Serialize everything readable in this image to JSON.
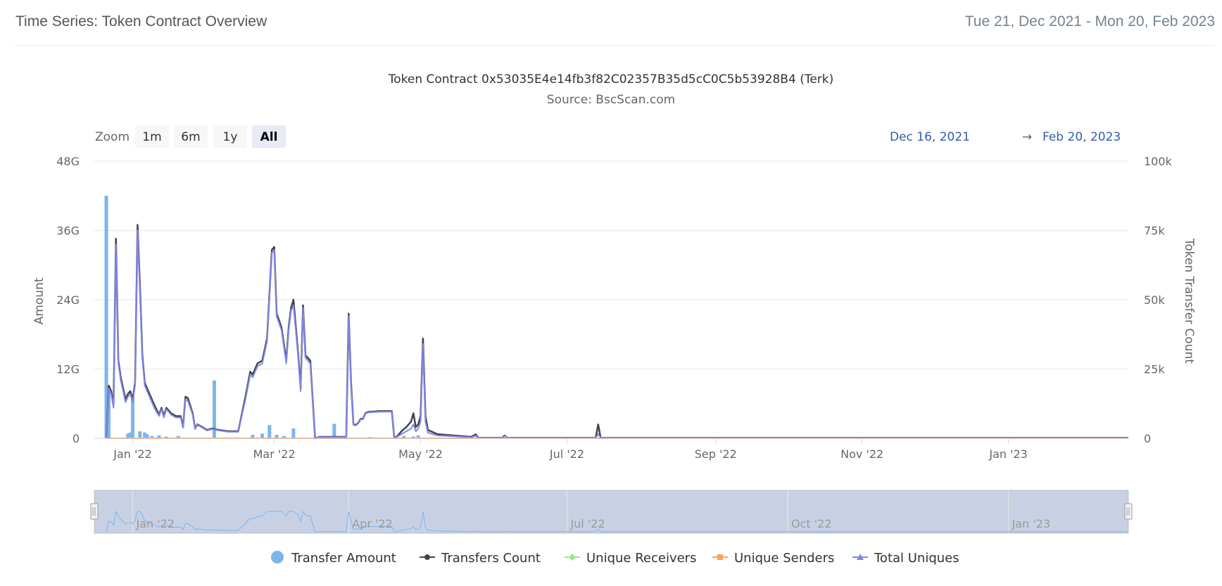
{
  "header": {
    "title": "Time Series: Token Contract Overview",
    "date_range": "Tue 21, Dec 2021 - Mon 20, Feb 2023"
  },
  "chart_data": {
    "type": "line",
    "title": "Token Contract 0x53035E4e14fb3f82C02357B35d5cC0C5b53928B4 (Terk)",
    "subtitle": "Source: BscScan.com",
    "zoom": {
      "label": "Zoom",
      "buttons": [
        "1m",
        "6m",
        "1y",
        "All"
      ],
      "selected": "All"
    },
    "range_selector": {
      "from": "Dec 16, 2021",
      "arrow": "→",
      "to": "Feb 20, 2023"
    },
    "x_start": "2021-12-16",
    "x_end": "2023-02-20",
    "xticks": [
      {
        "label": "Jan '22",
        "date": "2022-01-01"
      },
      {
        "label": "Mar '22",
        "date": "2022-03-01"
      },
      {
        "label": "May '22",
        "date": "2022-05-01"
      },
      {
        "label": "Jul '22",
        "date": "2022-07-01"
      },
      {
        "label": "Sep '22",
        "date": "2022-09-01"
      },
      {
        "label": "Nov '22",
        "date": "2022-11-01"
      },
      {
        "label": "Jan '23",
        "date": "2023-01-01"
      }
    ],
    "navigator_ticks": [
      {
        "label": "Jan '22",
        "date": "2022-01-01"
      },
      {
        "label": "Apr '22",
        "date": "2022-04-01"
      },
      {
        "label": "Jul '22",
        "date": "2022-07-01"
      },
      {
        "label": "Oct '22",
        "date": "2022-10-01"
      },
      {
        "label": "Jan '23",
        "date": "2023-01-01"
      }
    ],
    "y_left": {
      "label": "Amount",
      "ticks": [
        "0",
        "12G",
        "24G",
        "36G",
        "48G"
      ],
      "max": 48
    },
    "y_right": {
      "label": "Token Transfer Count",
      "ticks": [
        "0",
        "25k",
        "50k",
        "75k",
        "100k"
      ],
      "max": 100000
    },
    "grid": true,
    "legend_position": "bottom",
    "colors": {
      "transfer_amount": "#7cb5ec",
      "transfers_count": "#434348",
      "unique_receivers": "#90ed7d",
      "unique_senders": "#f7a35c",
      "total_uniques": "#8085e9"
    },
    "series": [
      {
        "name": "Transfer Amount",
        "type": "column",
        "axis": "left",
        "unit": "G",
        "points": [
          [
            "2021-12-21",
            42
          ],
          [
            "2021-12-22",
            8
          ],
          [
            "2021-12-30",
            0.8
          ],
          [
            "2021-12-31",
            1.0
          ],
          [
            "2022-01-01",
            7.5
          ],
          [
            "2022-01-04",
            1.2
          ],
          [
            "2022-01-06",
            1.0
          ],
          [
            "2022-01-07",
            0.7
          ],
          [
            "2022-01-09",
            0.4
          ],
          [
            "2022-01-12",
            0.5
          ],
          [
            "2022-01-15",
            0.3
          ],
          [
            "2022-01-20",
            0.4
          ],
          [
            "2022-02-04",
            10
          ],
          [
            "2022-02-20",
            0.6
          ],
          [
            "2022-02-24",
            0.8
          ],
          [
            "2022-02-27",
            2.3
          ],
          [
            "2022-03-02",
            0.6
          ],
          [
            "2022-03-05",
            0.4
          ],
          [
            "2022-03-09",
            1.7
          ],
          [
            "2022-03-26",
            2.5
          ],
          [
            "2022-04-10",
            0.2
          ],
          [
            "2022-04-24",
            0.4
          ],
          [
            "2022-04-28",
            0.3
          ],
          [
            "2022-04-30",
            0.5
          ]
        ]
      },
      {
        "name": "Transfers Count",
        "axis": "right",
        "points": [
          [
            "2021-12-21",
            0
          ],
          [
            "2021-12-22",
            19000
          ],
          [
            "2021-12-23",
            17000
          ],
          [
            "2021-12-24",
            12000
          ],
          [
            "2021-12-25",
            72000
          ],
          [
            "2021-12-26",
            28000
          ],
          [
            "2021-12-27",
            22000
          ],
          [
            "2021-12-28",
            18000
          ],
          [
            "2021-12-29",
            14000
          ],
          [
            "2021-12-30",
            16000
          ],
          [
            "2021-12-31",
            17000
          ],
          [
            "2022-01-01",
            14000
          ],
          [
            "2022-01-02",
            20000
          ],
          [
            "2022-01-03",
            77000
          ],
          [
            "2022-01-04",
            55000
          ],
          [
            "2022-01-05",
            30000
          ],
          [
            "2022-01-06",
            20000
          ],
          [
            "2022-01-08",
            16000
          ],
          [
            "2022-01-10",
            12000
          ],
          [
            "2022-01-12",
            8500
          ],
          [
            "2022-01-13",
            11000
          ],
          [
            "2022-01-14",
            8000
          ],
          [
            "2022-01-15",
            11000
          ],
          [
            "2022-01-17",
            9000
          ],
          [
            "2022-01-19",
            8000
          ],
          [
            "2022-01-21",
            8000
          ],
          [
            "2022-01-22",
            4000
          ],
          [
            "2022-01-23",
            15000
          ],
          [
            "2022-01-24",
            14500
          ],
          [
            "2022-01-26",
            9000
          ],
          [
            "2022-01-27",
            3500
          ],
          [
            "2022-01-28",
            5000
          ],
          [
            "2022-01-30",
            4000
          ],
          [
            "2022-02-01",
            3000
          ],
          [
            "2022-02-03",
            3500
          ],
          [
            "2022-02-06",
            3000
          ],
          [
            "2022-02-10",
            2500
          ],
          [
            "2022-02-14",
            2500
          ],
          [
            "2022-02-17",
            15000
          ],
          [
            "2022-02-19",
            24000
          ],
          [
            "2022-02-20",
            23000
          ],
          [
            "2022-02-22",
            27000
          ],
          [
            "2022-02-24",
            28000
          ],
          [
            "2022-02-26",
            36000
          ],
          [
            "2022-02-28",
            68000
          ],
          [
            "2022-03-01",
            69000
          ],
          [
            "2022-03-02",
            45000
          ],
          [
            "2022-03-04",
            40000
          ],
          [
            "2022-03-06",
            28000
          ],
          [
            "2022-03-07",
            40000
          ],
          [
            "2022-03-08",
            47000
          ],
          [
            "2022-03-09",
            50000
          ],
          [
            "2022-03-11",
            30000
          ],
          [
            "2022-03-12",
            18000
          ],
          [
            "2022-03-13",
            48000
          ],
          [
            "2022-03-14",
            30000
          ],
          [
            "2022-03-16",
            28000
          ],
          [
            "2022-03-18",
            0
          ],
          [
            "2022-03-20",
            500
          ],
          [
            "2022-03-31",
            500
          ],
          [
            "2022-04-01",
            45000
          ],
          [
            "2022-04-02",
            20000
          ],
          [
            "2022-04-03",
            5000
          ],
          [
            "2022-04-04",
            4800
          ],
          [
            "2022-04-05",
            5500
          ],
          [
            "2022-04-06",
            7000
          ],
          [
            "2022-04-07",
            7000
          ],
          [
            "2022-04-08",
            9000
          ],
          [
            "2022-04-09",
            9500
          ],
          [
            "2022-04-14",
            9800
          ],
          [
            "2022-04-19",
            9800
          ],
          [
            "2022-04-20",
            500
          ],
          [
            "2022-04-21",
            500
          ],
          [
            "2022-04-23",
            2500
          ],
          [
            "2022-04-25",
            4000
          ],
          [
            "2022-04-27",
            6000
          ],
          [
            "2022-04-28",
            9000
          ],
          [
            "2022-04-29",
            4000
          ],
          [
            "2022-04-30",
            5000
          ],
          [
            "2022-05-01",
            8000
          ],
          [
            "2022-05-02",
            36000
          ],
          [
            "2022-05-03",
            8000
          ],
          [
            "2022-05-04",
            3000
          ],
          [
            "2022-05-08",
            1500
          ],
          [
            "2022-05-15",
            1000
          ],
          [
            "2022-05-22",
            500
          ],
          [
            "2022-05-24",
            1400
          ],
          [
            "2022-05-25",
            200
          ],
          [
            "2022-06-04",
            200
          ],
          [
            "2022-06-05",
            1000
          ],
          [
            "2022-06-06",
            200
          ],
          [
            "2022-07-13",
            200
          ],
          [
            "2022-07-14",
            5000
          ],
          [
            "2022-07-15",
            200
          ],
          [
            "2023-02-20",
            200
          ]
        ]
      },
      {
        "name": "Unique Receivers",
        "axis": "right",
        "points": [
          [
            "2021-12-21",
            0
          ],
          [
            "2023-02-20",
            0
          ]
        ]
      },
      {
        "name": "Unique Senders",
        "axis": "right",
        "points": [
          [
            "2021-12-21",
            0
          ],
          [
            "2023-02-20",
            0
          ]
        ]
      },
      {
        "name": "Total Uniques",
        "axis": "right",
        "points": [
          [
            "2021-12-21",
            0
          ],
          [
            "2021-12-22",
            18000
          ],
          [
            "2021-12-23",
            16000
          ],
          [
            "2021-12-24",
            11000
          ],
          [
            "2021-12-25",
            70000
          ],
          [
            "2021-12-26",
            27000
          ],
          [
            "2021-12-27",
            21000
          ],
          [
            "2021-12-28",
            17000
          ],
          [
            "2021-12-29",
            13000
          ],
          [
            "2021-12-30",
            15000
          ],
          [
            "2021-12-31",
            16000
          ],
          [
            "2022-01-01",
            13000
          ],
          [
            "2022-01-02",
            19000
          ],
          [
            "2022-01-03",
            75000
          ],
          [
            "2022-01-04",
            53000
          ],
          [
            "2022-01-05",
            29000
          ],
          [
            "2022-01-06",
            19000
          ],
          [
            "2022-01-08",
            15000
          ],
          [
            "2022-01-10",
            11000
          ],
          [
            "2022-01-12",
            8000
          ],
          [
            "2022-01-13",
            10500
          ],
          [
            "2022-01-14",
            7500
          ],
          [
            "2022-01-15",
            10500
          ],
          [
            "2022-01-17",
            8500
          ],
          [
            "2022-01-19",
            7500
          ],
          [
            "2022-01-21",
            7500
          ],
          [
            "2022-01-22",
            3800
          ],
          [
            "2022-01-23",
            14000
          ],
          [
            "2022-01-24",
            13500
          ],
          [
            "2022-01-26",
            8500
          ],
          [
            "2022-01-27",
            3300
          ],
          [
            "2022-01-28",
            4800
          ],
          [
            "2022-01-30",
            3800
          ],
          [
            "2022-02-01",
            2800
          ],
          [
            "2022-02-03",
            3300
          ],
          [
            "2022-02-06",
            2800
          ],
          [
            "2022-02-10",
            2300
          ],
          [
            "2022-02-14",
            2300
          ],
          [
            "2022-02-17",
            14000
          ],
          [
            "2022-02-19",
            23000
          ],
          [
            "2022-02-20",
            22000
          ],
          [
            "2022-02-22",
            26000
          ],
          [
            "2022-02-24",
            27000
          ],
          [
            "2022-02-26",
            35000
          ],
          [
            "2022-02-28",
            67000
          ],
          [
            "2022-03-01",
            68000
          ],
          [
            "2022-03-02",
            44000
          ],
          [
            "2022-03-04",
            39000
          ],
          [
            "2022-03-06",
            27000
          ],
          [
            "2022-03-07",
            39000
          ],
          [
            "2022-03-08",
            46000
          ],
          [
            "2022-03-09",
            48000
          ],
          [
            "2022-03-11",
            29000
          ],
          [
            "2022-03-12",
            17000
          ],
          [
            "2022-03-13",
            47000
          ],
          [
            "2022-03-14",
            29000
          ],
          [
            "2022-03-16",
            27000
          ],
          [
            "2022-03-18",
            0
          ],
          [
            "2022-03-20",
            400
          ],
          [
            "2022-03-31",
            400
          ],
          [
            "2022-04-01",
            44000
          ],
          [
            "2022-04-02",
            19000
          ],
          [
            "2022-04-03",
            4800
          ],
          [
            "2022-04-04",
            4600
          ],
          [
            "2022-04-05",
            5300
          ],
          [
            "2022-04-06",
            6800
          ],
          [
            "2022-04-07",
            6800
          ],
          [
            "2022-04-08",
            8800
          ],
          [
            "2022-04-09",
            9300
          ],
          [
            "2022-04-14",
            9600
          ],
          [
            "2022-04-19",
            9600
          ],
          [
            "2022-04-20",
            400
          ],
          [
            "2022-04-21",
            400
          ],
          [
            "2022-04-23",
            1500
          ],
          [
            "2022-04-25",
            2500
          ],
          [
            "2022-04-27",
            3500
          ],
          [
            "2022-04-28",
            5000
          ],
          [
            "2022-04-29",
            2500
          ],
          [
            "2022-04-30",
            3500
          ],
          [
            "2022-05-01",
            6000
          ],
          [
            "2022-05-02",
            34000
          ],
          [
            "2022-05-03",
            6000
          ],
          [
            "2022-05-04",
            2000
          ],
          [
            "2022-05-08",
            1000
          ],
          [
            "2022-05-15",
            700
          ],
          [
            "2022-05-22",
            300
          ],
          [
            "2022-05-24",
            900
          ],
          [
            "2022-05-25",
            150
          ],
          [
            "2022-06-04",
            150
          ],
          [
            "2022-06-05",
            800
          ],
          [
            "2022-06-06",
            150
          ],
          [
            "2022-07-13",
            150
          ],
          [
            "2022-07-14",
            1500
          ],
          [
            "2022-07-15",
            150
          ],
          [
            "2023-02-20",
            150
          ]
        ]
      }
    ]
  }
}
